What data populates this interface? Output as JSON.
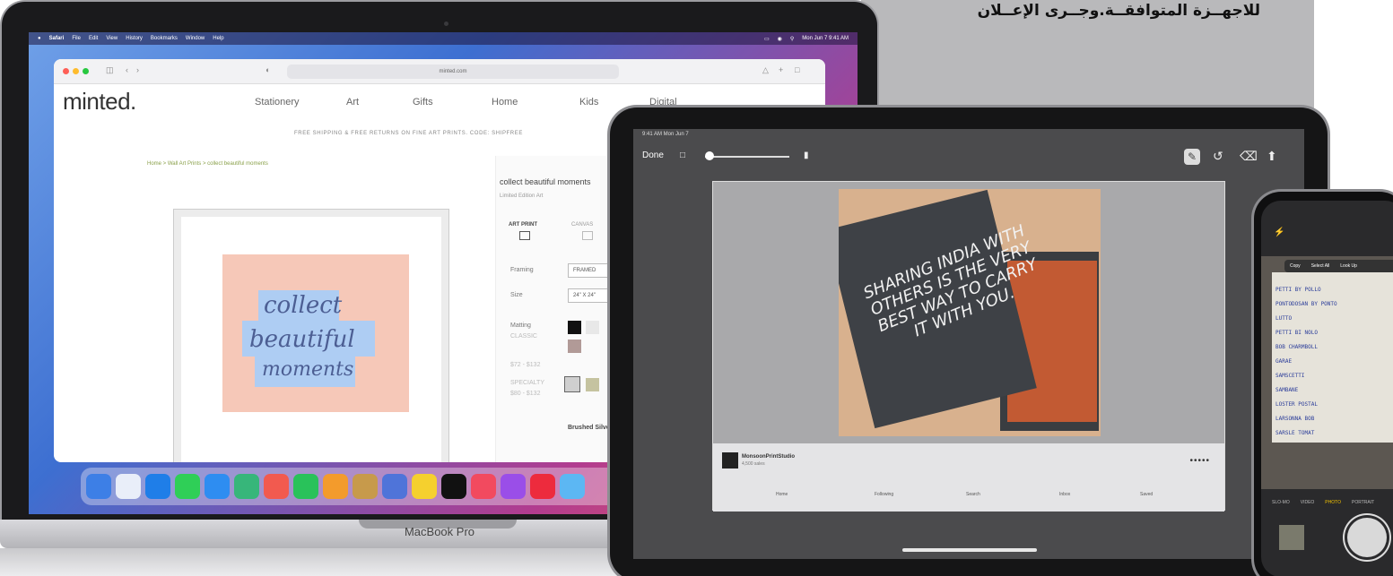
{
  "caption_arabic": "للاجهــزة المتوافقــة.وجــرى الإعــلان",
  "macbook": {
    "label": "MacBook Pro",
    "menubar": {
      "items": [
        "Safari",
        "File",
        "Edit",
        "View",
        "History",
        "Bookmarks",
        "Window",
        "Help"
      ],
      "clock": "Mon Jun 7  9:41 AM"
    },
    "safari": {
      "address": "minted.com"
    },
    "site": {
      "logo": "minted.",
      "nav": [
        "Stationery",
        "Art",
        "Gifts",
        "Home",
        "Kids",
        "Digital"
      ],
      "promo": "FREE SHIPPING & FREE RETURNS ON FINE ART PRINTS. CODE: SHIPFREE",
      "breadcrumb": "Home  >  Wall Art Prints  >  collect beautiful moments",
      "art_text": [
        "collect",
        "beautiful",
        "moments"
      ],
      "product_title": "collect beautiful moments",
      "product_sub": "Limited Edition Art",
      "options": [
        "ART PRINT",
        "CANVAS"
      ],
      "framing_label": "Framing",
      "framing_value": "FRAMED",
      "size_label": "Size",
      "size_value": "24\" X 24\"",
      "matting_label": "Matting",
      "matting_value": "CLASSIC",
      "price_1": "$72 - $132",
      "specialty_label": "SPECIALTY",
      "price_2": "$80 - $132",
      "finish_label": "Brushed Silver"
    },
    "dock_colors": [
      "#3d7fe6",
      "#e9eef9",
      "#1f7ee8",
      "#2fcf57",
      "#2e8df1",
      "#37b67a",
      "#f25a4f",
      "#29c25a",
      "#f39b2c",
      "#c79a4b",
      "#4f74d9",
      "#f5d02e",
      "#111111",
      "#f24a5f",
      "#9a4ee8",
      "#ed2b3d",
      "#5cb7f3"
    ]
  },
  "ipad": {
    "status_time": "9:41 AM  Mon Jun 7",
    "done_label": "Done",
    "photo_text": "SHARING INDIA WITH OTHERS IS THE VERY BEST WAY TO CARRY IT WITH YOU.",
    "pin_name": "MonsoonPrintStudio",
    "pin_sub": "4,500 sales",
    "more": "•••••",
    "tabs": [
      "Home",
      "Following",
      "Search",
      "Inbox",
      "Saved"
    ]
  },
  "iphone": {
    "popover": [
      "Copy",
      "Select All",
      "Look Up"
    ],
    "notes": [
      "PETTI BY POLLO",
      "PONTODOSAN BY PONTO",
      "LUTTO",
      "PETTI BI NOLO",
      "BOB CHARMBOLL",
      "GARAE",
      "SAMSCETTI",
      "SAMBANE",
      "LOSTER POSTAL",
      "LARSONNA BOB",
      "SARSLE TOMAT"
    ],
    "modes": [
      "SLO-MO",
      "VIDEO",
      "PHOTO",
      "PORTRAIT"
    ]
  }
}
